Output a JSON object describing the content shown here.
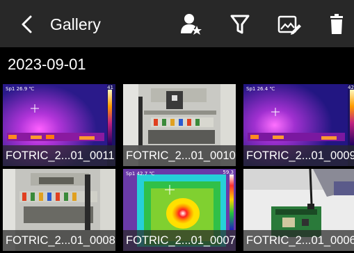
{
  "header": {
    "title": "Gallery",
    "back_icon": "chevron-left-icon",
    "actions": [
      {
        "name": "user-star-icon"
      },
      {
        "name": "filter-icon"
      },
      {
        "name": "image-edit-icon"
      },
      {
        "name": "trash-icon"
      }
    ]
  },
  "section": {
    "date": "2023-09-01"
  },
  "thumbnails": [
    {
      "caption": "FOTRIC_2...01_0011",
      "type": "thermal",
      "selected": true,
      "spot": "Sp1  26.9 ℃",
      "scale_max": "41"
    },
    {
      "caption": "FOTRIC_2...01_0010",
      "type": "photo",
      "selected": false
    },
    {
      "caption": "FOTRIC_2...01_0009",
      "type": "thermal",
      "selected": false,
      "spot": "Sp1  26.4 ℃",
      "scale_max": "42"
    },
    {
      "caption": "FOTRIC_2...01_0008",
      "type": "photo",
      "selected": false
    },
    {
      "caption": "FOTRIC_2...01_0007",
      "type": "thermal",
      "selected": false,
      "spot": "Sp1  42.7 ℃",
      "scale_max": "59.3"
    },
    {
      "caption": "FOTRIC_2...01_0006",
      "type": "photo",
      "selected": false
    }
  ],
  "colors": {
    "topbar": "#282828",
    "background": "#000000",
    "selection": "#1f6fe0"
  }
}
